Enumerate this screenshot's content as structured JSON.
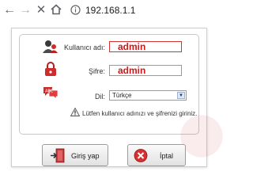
{
  "browser": {
    "url": "192.168.1.1"
  },
  "login": {
    "username_label": "Kullanıcı adı:",
    "username_value": "admin",
    "password_label": "Şifre:",
    "password_value": "admin",
    "language_label": "Dil:",
    "language_value": "Türkçe",
    "warning_text": "Lütfen kullanıcı adınızı ve şifrenizi giriniz.",
    "login_button": "Giriş yap",
    "cancel_button": "İptal"
  },
  "icons": {
    "back": "arrow-left-icon",
    "forward": "arrow-right-icon",
    "stop": "close-icon",
    "home": "home-icon",
    "info": "info-icon",
    "user": "user-icon",
    "lock": "lock-icon",
    "language": "language-icon",
    "warning": "warning-icon",
    "login": "door-enter-icon",
    "cancel": "cancel-icon"
  },
  "colors": {
    "credential_text": "#d01818",
    "accent_red": "#c0001a"
  }
}
